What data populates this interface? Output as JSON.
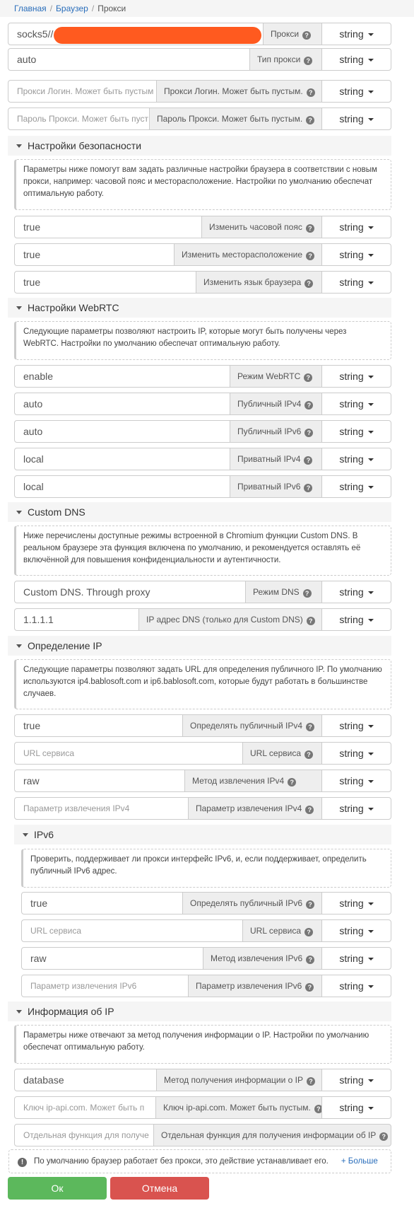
{
  "breadcrumb": {
    "home": "Главная",
    "browser": "Браузер",
    "current": "Прокси"
  },
  "type_label": "string",
  "fields": [
    {
      "value": "socks5//",
      "label": "Прокси",
      "placeholder": false
    },
    {
      "value": "auto",
      "label": "Тип прокси",
      "placeholder": false
    },
    {
      "value": "Прокси Логин. Может быть пустым",
      "label": "Прокси Логин. Может быть пустым.",
      "placeholder": true
    },
    {
      "value": "Пароль Прокси. Может быть пуст",
      "label": "Пароль Прокси. Может быть пустым.",
      "placeholder": true
    },
    {
      "value": "true",
      "label": "Изменить часовой пояс",
      "placeholder": false
    },
    {
      "value": "true",
      "label": "Изменить месторасположение",
      "placeholder": false
    },
    {
      "value": "true",
      "label": "Изменить язык браузера",
      "placeholder": false
    },
    {
      "value": "enable",
      "label": "Режим WebRTC",
      "placeholder": false
    },
    {
      "value": "auto",
      "label": "Публичный IPv4",
      "placeholder": false
    },
    {
      "value": "auto",
      "label": "Публичный IPv6",
      "placeholder": false
    },
    {
      "value": "local",
      "label": "Приватный IPv4",
      "placeholder": false
    },
    {
      "value": "local",
      "label": "Приватный IPv6",
      "placeholder": false
    },
    {
      "value": "Custom DNS. Through proxy",
      "label": "Режим DNS",
      "placeholder": false
    },
    {
      "value": "1.1.1.1",
      "label": "IP адрес DNS (только для Custom DNS)",
      "placeholder": false
    },
    {
      "value": "true",
      "label": "Определять публичный IPv4",
      "placeholder": false
    },
    {
      "value": "URL сервиса",
      "label": "URL сервиса",
      "placeholder": true
    },
    {
      "value": "raw",
      "label": "Метод извлечения IPv4",
      "placeholder": false
    },
    {
      "value": "Параметр извлечения IPv4",
      "label": "Параметр извлечения IPv4",
      "placeholder": true
    },
    {
      "value": "true",
      "label": "Определять публичный IPv6",
      "placeholder": false
    },
    {
      "value": "URL сервиса",
      "label": "URL сервиса",
      "placeholder": true
    },
    {
      "value": "raw",
      "label": "Метод извлечения IPv6",
      "placeholder": false
    },
    {
      "value": "Параметр извлечения IPv6",
      "label": "Параметр извлечения IPv6",
      "placeholder": true
    },
    {
      "value": "database",
      "label": "Метод получения информации о IP",
      "placeholder": false
    },
    {
      "value": "Ключ ip-api.com. Может быть п",
      "label": "Ключ ip-api.com. Может быть пустым.",
      "placeholder": true
    },
    {
      "value": "Отдельная функция для получе",
      "label": "Отдельная функция для получения информации об IP",
      "placeholder": true
    }
  ],
  "sections": [
    {
      "title": "Настройки безопасности",
      "note": "Параметры ниже помогут вам задать различные настройки браузера в соответствии с новым прокси, например: часовой пояс и месторасположение. Настройки по умолчанию обеспечат оптимальную работу."
    },
    {
      "title": "Настройки WebRTC",
      "note": "Следующие параметры позволяют настроить IP, которые могут быть получены через WebRTC. Настройки по умолчанию обеспечат оптимальную работу."
    },
    {
      "title": "Custom DNS",
      "note": "Ниже перечислены доступные режимы встроенной в Chromium функции Custom DNS. В реальном браузере эта функция включена по умолчанию, и рекомендуется оставлять её включённой для повышения конфиденциальности и аутентичности."
    },
    {
      "title": "Определение IP",
      "note": "Следующие параметры позволяют задать URL для определения публичного IP. По умолчанию используются ip4.bablosoft.com и ip6.bablosoft.com, которые будут работать в большинстве случаев."
    },
    {
      "title": "IPv6",
      "note": "Проверить, поддерживает ли прокси интерфейс IPv6, и, если поддерживает, определить публичный IPv6 адрес."
    },
    {
      "title": "Информация об IP",
      "note": "Параметры ниже отвечают за метод получения информации о IP. Настройки по умолчанию обеспечат оптимальную работу."
    }
  ],
  "bottom_note": {
    "text": "По умолчанию браузер работает без прокси, это действие устанавливает его.",
    "more": "+ Больше"
  },
  "buttons": {
    "ok": "Ок",
    "cancel": "Отмена"
  },
  "redaction_color": "#ff5a1f"
}
